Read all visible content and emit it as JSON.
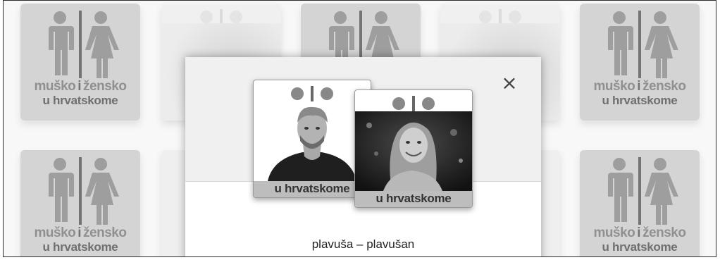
{
  "tiles": {
    "logo_line1_left": "muško",
    "logo_line1_mid": "i",
    "logo_line1_right": "žensko",
    "logo_line2": "u hrvatskome"
  },
  "modal": {
    "close_label": "×",
    "card_male": {
      "footer_text": "u hrvatskome"
    },
    "card_female": {
      "footer_text": "u hrvatskome"
    },
    "caption": "plavuša – plavušan"
  },
  "colors": {
    "tile_bg": "#bdbdbd",
    "logo_figures": "#6a6a6a"
  },
  "icons": {
    "close": "close-icon",
    "male_figure": "male-figure-icon",
    "female_figure": "female-figure-icon"
  }
}
